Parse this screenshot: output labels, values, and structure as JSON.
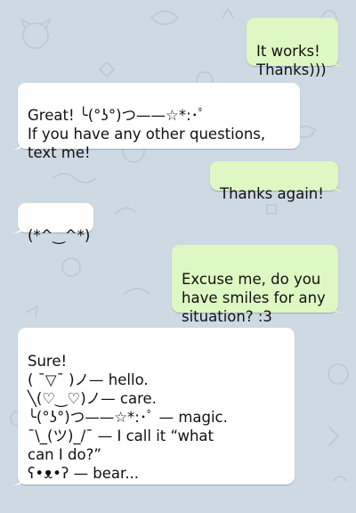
{
  "colors": {
    "background": "#cdd9e3",
    "outgoing_bubble": "#def8c3",
    "incoming_bubble": "#ffffff",
    "text": "#111111"
  },
  "messages": [
    {
      "direction": "outgoing",
      "text": "It works!\nThanks)))"
    },
    {
      "direction": "incoming",
      "text": "Great! ╰(°ʖ°)つ——☆*:･ﾟ\nIf you have any other questions,\ntext me!"
    },
    {
      "direction": "outgoing",
      "text": "Thanks again!"
    },
    {
      "direction": "incoming",
      "text": "(*^‿^*)"
    },
    {
      "direction": "outgoing",
      "text": "Excuse me, do you\nhave smiles for any\nsituation? :3"
    },
    {
      "direction": "incoming",
      "text": "Sure!\n( ¯▽¯ )ノ— hello.\n╲(♡‿♡)ノ— care.\n╰(°ʖ°)つ——☆*:･ﾟ — magic.\n¯\\_(ツ)_/¯ — I call it “what\ncan I do?”\nʕ•ᴥ•ʔ — bear..."
    }
  ]
}
